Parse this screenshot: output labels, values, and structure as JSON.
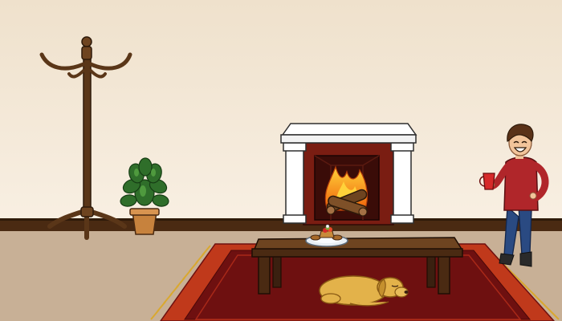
{
  "scene": {
    "type": "point-and-click room scene",
    "text_visible": false,
    "objects": [
      {
        "name": "coat-rack",
        "interactable": true
      },
      {
        "name": "potted-plant",
        "interactable": true
      },
      {
        "name": "fireplace",
        "interactable": true,
        "state": "burning"
      },
      {
        "name": "coffee-table",
        "interactable": true
      },
      {
        "name": "plate-of-cake",
        "interactable": true
      },
      {
        "name": "sleeping-dog",
        "interactable": true
      },
      {
        "name": "rug",
        "interactable": false
      },
      {
        "name": "person-with-mug",
        "interactable": true,
        "state": "laughing"
      }
    ]
  },
  "colors": {
    "wall": "#f4e8d6",
    "baseboard": "#4a2a12",
    "floor": "#c8b096",
    "rug_outer": "#c0391b",
    "rug_inner": "#6e1010",
    "rug_fringe": "#d9a830",
    "wood": "#5a3618",
    "brick": "#7a1d12",
    "fire": "#f07a10",
    "dog": "#e3b24a",
    "sweater": "#b0262a",
    "jeans": "#2a4a82"
  }
}
